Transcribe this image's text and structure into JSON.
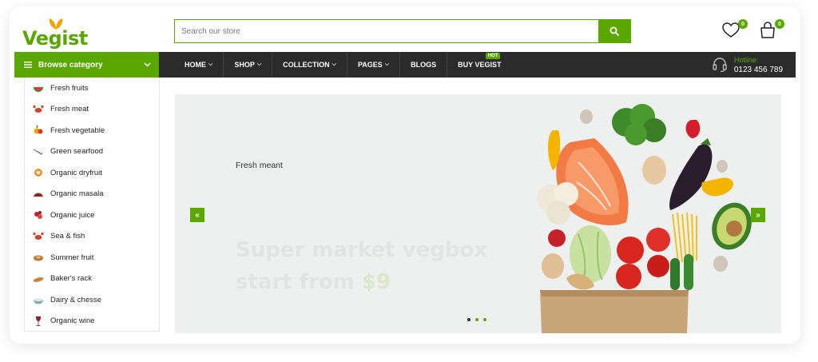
{
  "brand": {
    "name": "Vegist",
    "color": "#5aa700"
  },
  "search": {
    "placeholder": "Search our store",
    "icon": "search-icon"
  },
  "header": {
    "wishlist_count": "0",
    "cart_count": "0"
  },
  "nav": {
    "browse_label": "Browse category",
    "items": [
      {
        "label": "HOME",
        "caret": true
      },
      {
        "label": "SHOP",
        "caret": true
      },
      {
        "label": "COLLECTION",
        "caret": true
      },
      {
        "label": "PAGES",
        "caret": true
      },
      {
        "label": "BLOGS",
        "caret": false
      },
      {
        "label": "BUY VEGIST",
        "caret": false,
        "badge": "HOT"
      }
    ],
    "hotline_label": "Hotline:",
    "hotline_number": "0123 456 789"
  },
  "categories": [
    {
      "label": "Fresh fruits",
      "icon": "watermelon-icon"
    },
    {
      "label": "Fresh meat",
      "icon": "crab-icon"
    },
    {
      "label": "Fresh vegetable",
      "icon": "vegetable-icon"
    },
    {
      "label": "Green searfood",
      "icon": "fish-icon"
    },
    {
      "label": "Organic dryfruit",
      "icon": "dryfruit-icon"
    },
    {
      "label": "Organic masala",
      "icon": "masala-icon"
    },
    {
      "label": "Organic juice",
      "icon": "juice-icon"
    },
    {
      "label": "Sea & fish",
      "icon": "crab-icon"
    },
    {
      "label": "Summer fruit",
      "icon": "fruit-icon"
    },
    {
      "label": "Baker's rack",
      "icon": "bread-icon"
    },
    {
      "label": "Dairy & chesse",
      "icon": "dairy-icon"
    },
    {
      "label": "Organic wine",
      "icon": "wine-icon"
    }
  ],
  "hero": {
    "subtitle": "Fresh meant",
    "title_line1": "Super market vegbox",
    "title_line2": "start from",
    "price": "$9",
    "slides": 3,
    "active_slide": 1
  }
}
